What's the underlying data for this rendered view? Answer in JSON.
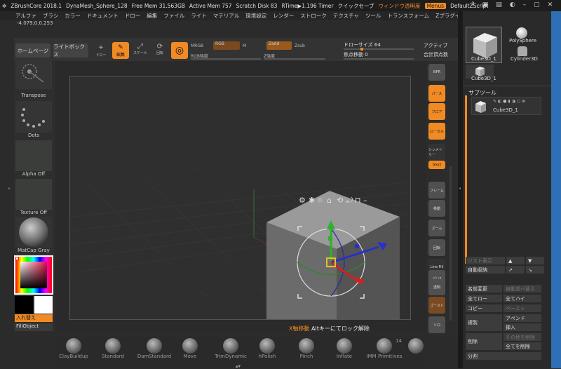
{
  "titlebar": {
    "app": "ZBrushCore 2018.1",
    "doc": "DynaMesh_Sphere_128",
    "free_mem": "Free Mem 31.563GB",
    "active_mem": "Active Mem 757",
    "scratch": "Scratch Disk 83",
    "rtime": "RTime▶1.196 Timer",
    "quicksave": "クイックセーブ",
    "transparency": "ウィンドウ透明度",
    "menus": "Menus",
    "script": "DefaultZScript"
  },
  "menubar": [
    "アルファ",
    "ブラシ",
    "カラー",
    "ドキュメント",
    "ドロー",
    "編集",
    "ファイル",
    "ライト",
    "マテリアル",
    "環境設定",
    "レンダー",
    "ストローク",
    "テクスチャ",
    "ツール",
    "トランスフォーム",
    "Zプラグイン"
  ],
  "coord": "-4.079,0,0.253",
  "topbar": {
    "home": "ホームページ",
    "lightbox": "ライトボックス",
    "draw_pointer": "ドロー",
    "edit": "編集",
    "scale": "スケール",
    "rotate": "回転",
    "mrgb": "MRGB",
    "rgb": "RGB",
    "m": "M",
    "zadd": "Zadd",
    "zsub": "Zsub",
    "rgb_intensity": "RGB強度",
    "z_intensity": "Z強度",
    "draw_size_label": "ドローサイズ",
    "draw_size": "64",
    "focal_label": "焦点移動",
    "focal": "0",
    "active": "アクティブ",
    "total_points": "合計頂点数"
  },
  "leftshelf": {
    "transpose": "Transpose",
    "dots": "Dots",
    "alpha": "Alpha Off",
    "texture": "Texture Off",
    "matcap": "MatCap Gray",
    "swap": "入れ替え",
    "fill": "FillObject"
  },
  "viewport": {
    "hint_key": "X軸移動",
    "hint_rest": "Altキーにてロック解除"
  },
  "rightshelf": [
    "BPR",
    "パース",
    "フロア",
    "ローカル",
    "シンメトリー",
    "Gxyz",
    "フレーム",
    "移動",
    "ズーム",
    "回転",
    "Line Fill",
    "ポリF",
    "透明",
    "ゴースト",
    "ソロ"
  ],
  "rightpanel": {
    "tool_main": "Cube3D_1",
    "tool_polysphere": "PolySphere",
    "tool_cylinder": "Cylinder3D",
    "tool_small": "Cube3D_1",
    "subtool_title": "サブツール",
    "subtool_name": "Cube3D_1",
    "list_show": "リスト表示",
    "auto_collapse": "自動収納",
    "rename": "名前変更",
    "auto_reorder": "自動並べ替え",
    "all_low": "全てロー",
    "all_high": "全てハイ",
    "copy": "コピー",
    "paste": "ペースト",
    "duplicate": "複製",
    "append": "アペンド",
    "insert": "挿入",
    "delete": "削除",
    "delete_others": "その他を削除",
    "delete_all": "全てを削除",
    "split": "分割"
  },
  "brushes": [
    "ClayBuildup",
    "Standard",
    "DamStandard",
    "Move",
    "TrimDynamic",
    "hPolish",
    "Pinch",
    "Inflate",
    "IMM Primitives"
  ],
  "brush_count": "14",
  "colors": {
    "accent": "#f08a24",
    "bg": "#2b2b2b"
  }
}
